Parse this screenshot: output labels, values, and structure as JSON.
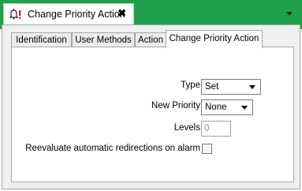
{
  "document_tab": {
    "title": "Change Priority Action",
    "close_glyph": "✖",
    "icon": "bell-priority-icon"
  },
  "tabs": [
    {
      "label": "Identification"
    },
    {
      "label": "User Methods"
    },
    {
      "label": "Action"
    },
    {
      "label": "Change Priority Action"
    }
  ],
  "form": {
    "type_label": "Type",
    "type_value": "Set",
    "new_priority_label": "New Priority",
    "new_priority_value": "None",
    "levels_label": "Levels",
    "levels_value": "0",
    "reevaluate_label": "Reevaluate automatic redirections on alarm",
    "reevaluate_checked": false
  },
  "colors": {
    "title_bar": "#1ea14a",
    "icon_red": "#c4262e"
  }
}
